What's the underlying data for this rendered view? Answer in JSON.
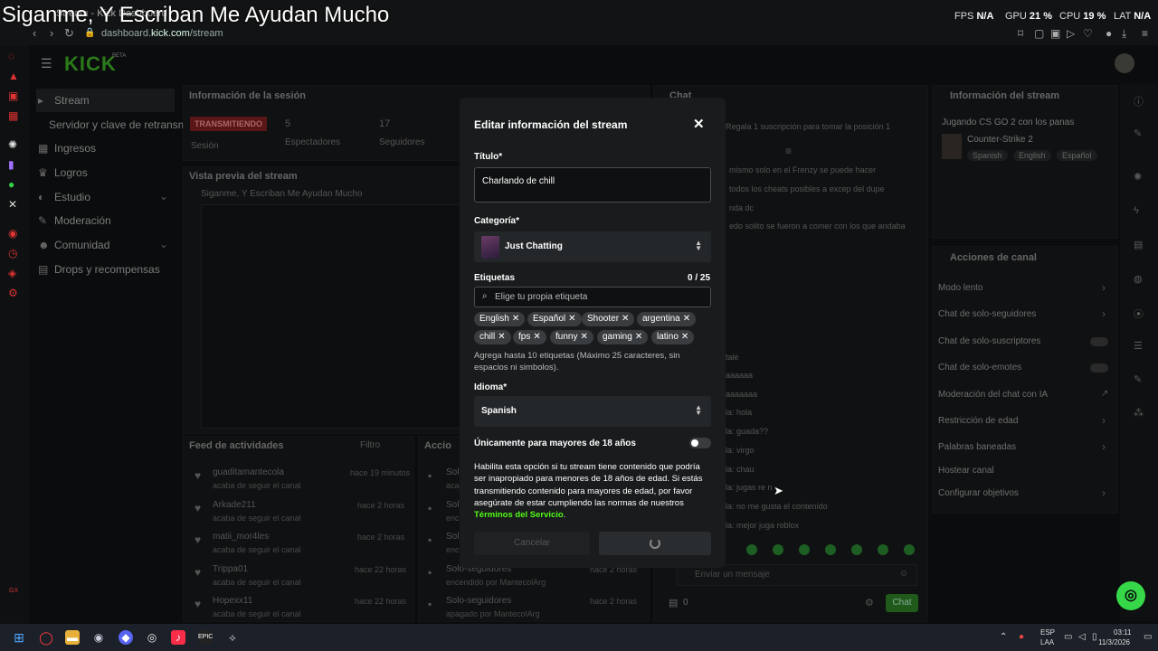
{
  "overlay_title": "Siganme, Y Escriban Me Ayudan Mucho",
  "browser": {
    "tab_title": "Stream - Kick Dashboard",
    "address_domain_prefix": "dashboard.",
    "address_domain": "kick.com",
    "address_path": "/stream",
    "perf": {
      "fps_label": "FPS",
      "fps_value": "N/A",
      "gpu_label": "GPU",
      "gpu_value": "21 %",
      "cpu_label": "CPU",
      "cpu_value": "19 %",
      "lat_label": "LAT",
      "lat_value": "N/A"
    }
  },
  "dashboard": {
    "logo": "KICK",
    "logo_badge": "BETA",
    "sidebar": [
      {
        "label": "Stream",
        "icon": "video-icon"
      },
      {
        "label": "Servidor y clave de retransm",
        "icon": ""
      },
      {
        "label": "Ingresos",
        "icon": "chart-icon"
      },
      {
        "label": "Logros",
        "icon": "trophy-icon"
      },
      {
        "label": "Estudio",
        "icon": "palette-icon"
      },
      {
        "label": "Moderación",
        "icon": "wrench-icon"
      },
      {
        "label": "Comunidad",
        "icon": "users-icon"
      },
      {
        "label": "Drops y recompensas",
        "icon": "gift-icon"
      }
    ],
    "session": {
      "header": "Información de la sesión",
      "live_badge": "TRANSMITIENDO",
      "session_label": "Sesión",
      "viewers_value": "5",
      "viewers_label": "Espectadores",
      "followers_value": "17",
      "followers_label": "Seguidores"
    },
    "preview": {
      "header": "Vista previa del stream",
      "title": "Siganme, Y Escriban Me Ayudan Mucho"
    },
    "chat": {
      "header": "Chat",
      "gift_line": "Regala 1 suscripción para tomar la posición 1",
      "lines": [
        "mismo solo en el Frenzy se puede hacer",
        "todos los cheats posibles a excep del dupe",
        "nda dc",
        "edo solito se fueron a comer con los que andaba",
        "tale",
        "aaaaaa",
        "aaaaaaa",
        "la: hola",
        "la: guada??",
        "la: virgo",
        "la: chau",
        "la: jugas re n",
        "la: no me gusta el contenido",
        "la: mejor juga roblox"
      ],
      "input_placeholder": "Enviar un mensaje",
      "count": "0",
      "send": "Chat"
    },
    "stream_info": {
      "header": "Información del stream",
      "title": "Jugando CS GO 2 con los panas",
      "game": "Counter-Strike 2",
      "tags": [
        "Spanish",
        "English",
        "Español"
      ]
    },
    "channel_actions": {
      "header": "Acciones de canal",
      "items": [
        "Modo lento",
        "Chat de solo-seguidores",
        "Chat de solo-suscriptores",
        "Chat de solo-emotes",
        "Moderación del chat con IA",
        "Restricción de edad",
        "Palabras baneadas",
        "Hostear canal",
        "Configurar objetivos"
      ]
    },
    "feed": {
      "header": "Feed de actividades",
      "filter": "Filtro",
      "items": [
        {
          "name": "guaditamantecola",
          "action": "acaba de seguir el canal",
          "time": "hace 19 minutos"
        },
        {
          "name": "Arkade211",
          "action": "acaba de seguir el canal",
          "time": "hace 2 horas"
        },
        {
          "name": "matii_mor4les",
          "action": "acaba de seguir el canal",
          "time": "hace 2 horas"
        },
        {
          "name": "Trippa01",
          "action": "acaba de seguir el canal",
          "time": "hace 22 horas"
        },
        {
          "name": "Hopexx11",
          "action": "acaba de seguir el canal",
          "time": "hace 22 horas"
        }
      ]
    },
    "actions_log": {
      "header": "Accio",
      "items": [
        {
          "name": "Sol",
          "sub": "acab",
          "time": ""
        },
        {
          "name": "Sol",
          "sub": "enc",
          "time": ""
        },
        {
          "name": "Sol",
          "sub": "enc",
          "time": ""
        },
        {
          "name": "Solo-seguidores",
          "sub": "encendido por MantecolArg",
          "time": "hace 2 horas"
        },
        {
          "name": "Solo-seguidores",
          "sub": "apagado por MantecolArg",
          "time": "hace 2 horas"
        }
      ]
    }
  },
  "modal": {
    "title": "Editar información del stream",
    "title_label": "Título*",
    "title_value": "Charlando de chill",
    "category_label": "Categoría*",
    "category_value": "Just Chatting",
    "tags_label": "Etiquetas",
    "tags_count": "0 / 25",
    "tags_placeholder": "Elige tu propia etiqueta",
    "tags": [
      "English",
      "Español",
      "Shooter",
      "argentina",
      "chill",
      "fps",
      "funny",
      "gaming",
      "latino"
    ],
    "tags_help": "Agrega hasta 10 etiquetas (Máximo 25 caracteres, sin espacios ni simbolos).",
    "language_label": "Idioma*",
    "language_value": "Spanish",
    "adult_label": "Únicamente para mayores de 18 años",
    "adult_on": false,
    "adult_desc": "Habilita esta opción si tu stream tiene contenido que podría ser inapropiado para menores de 18 años de edad. Si estás transmitiendo contenido para mayores de edad, por favor asegúrate de estar cumpliendo las normas de nuestros",
    "terms_link": "Términos del Servicio",
    "terms_end": ".",
    "cancel": "Cancelar"
  },
  "taskbar": {
    "lang": "ESP",
    "lang2": "LAA",
    "time": "03:11",
    "date": "11/3/2026"
  },
  "colors": {
    "accent": "#53fc18",
    "live": "#5a1616"
  }
}
